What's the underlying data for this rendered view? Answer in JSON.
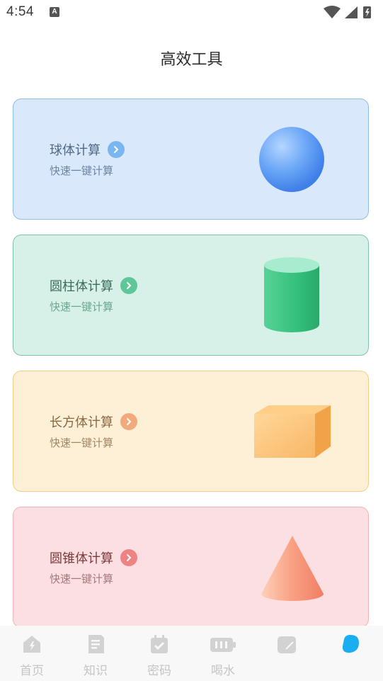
{
  "status": {
    "time": "4:54",
    "badge": "A"
  },
  "header": {
    "title": "高效工具"
  },
  "cards": [
    {
      "title": "球体计算",
      "subtitle": "快速一键计算"
    },
    {
      "title": "圆柱体计算",
      "subtitle": "快速一键计算"
    },
    {
      "title": "长方体计算",
      "subtitle": "快速一键计算"
    },
    {
      "title": "圆锥体计算",
      "subtitle": "快速一键计算"
    }
  ],
  "tabs": [
    {
      "label": "首页",
      "icon": "home-icon"
    },
    {
      "label": "知识",
      "icon": "document-icon"
    },
    {
      "label": "密码",
      "icon": "calendar-check-icon"
    },
    {
      "label": "喝水",
      "icon": "battery-icon"
    },
    {
      "label": "",
      "icon": "note-icon"
    },
    {
      "label": "",
      "icon": "active-blob-icon"
    }
  ],
  "colors": {
    "sphere_card_bg": "#d9e8fb",
    "sphere_card_border": "#8fbde0",
    "sphere_accent": "#7ab6f2",
    "cylinder_card_bg": "#d7f1e8",
    "cylinder_card_border": "#7fc4a8",
    "cylinder_accent": "#5ec79a",
    "box_card_bg": "#fdf0d6",
    "box_card_border": "#f1cd84",
    "box_accent": "#f2a97b",
    "cone_card_bg": "#fbdfe2",
    "cone_card_border": "#f0b3b8",
    "cone_accent": "#ef8383"
  }
}
